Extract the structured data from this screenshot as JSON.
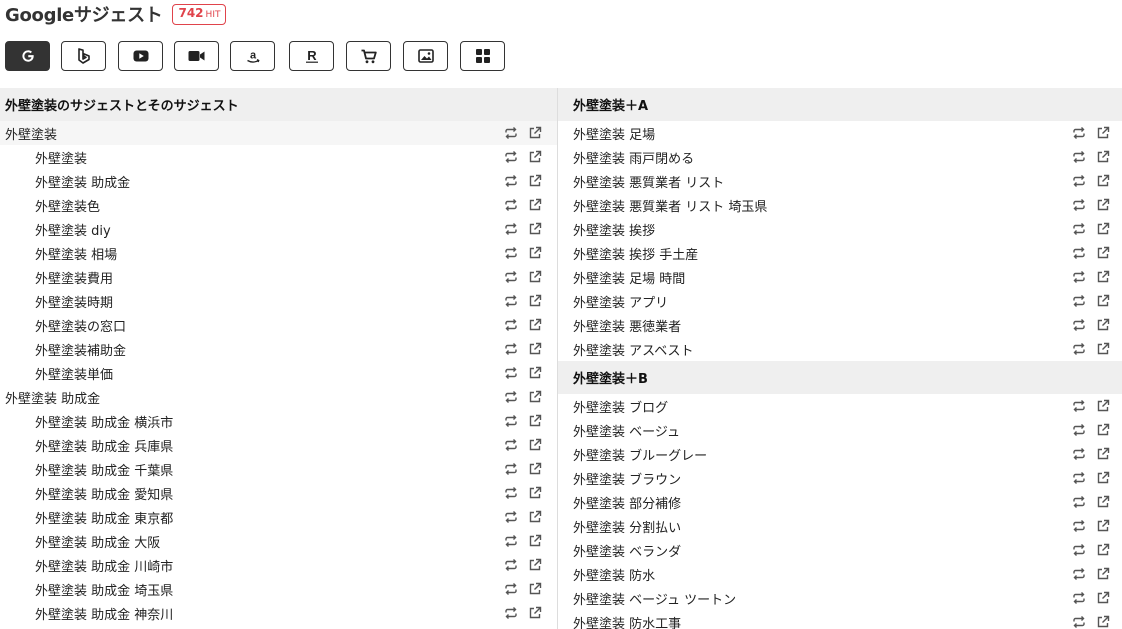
{
  "page": {
    "title": "Googleサジェスト",
    "hit_count": "742",
    "hit_label": "HIT"
  },
  "tabs": [
    {
      "name": "google",
      "icon": "google-icon",
      "active": true
    },
    {
      "name": "bing",
      "icon": "bing-icon",
      "active": false
    },
    {
      "name": "youtube",
      "icon": "youtube-icon",
      "active": false
    },
    {
      "name": "video",
      "icon": "video-camera-icon",
      "active": false
    },
    {
      "name": "amazon",
      "icon": "amazon-icon",
      "active": false
    },
    {
      "name": "rakuten",
      "icon": "rakuten-icon",
      "active": false
    },
    {
      "name": "shopping",
      "icon": "cart-icon",
      "active": false
    },
    {
      "name": "image",
      "icon": "image-icon",
      "active": false
    },
    {
      "name": "apps",
      "icon": "grid-icon",
      "active": false
    }
  ],
  "left_section": {
    "header": "外壁塗装のサジェストとそのサジェスト",
    "groups": [
      {
        "label": "外壁塗装",
        "children": [
          "外壁塗装",
          "外壁塗装 助成金",
          "外壁塗装色",
          "外壁塗装 diy",
          "外壁塗装 相場",
          "外壁塗装費用",
          "外壁塗装時期",
          "外壁塗装の窓口",
          "外壁塗装補助金",
          "外壁塗装単価"
        ]
      },
      {
        "label": "外壁塗装 助成金",
        "children": [
          "外壁塗装 助成金 横浜市",
          "外壁塗装 助成金 兵庫県",
          "外壁塗装 助成金 千葉県",
          "外壁塗装 助成金 愛知県",
          "外壁塗装 助成金 東京都",
          "外壁塗装 助成金 大阪",
          "外壁塗装 助成金 川崎市",
          "外壁塗装 助成金 埼玉県",
          "外壁塗装 助成金 神奈川"
        ]
      }
    ]
  },
  "right_sections": [
    {
      "header": "外壁塗装＋A",
      "items": [
        "外壁塗装 足場",
        "外壁塗装 雨戸閉める",
        "外壁塗装 悪質業者 リスト",
        "外壁塗装 悪質業者 リスト 埼玉県",
        "外壁塗装 挨拶",
        "外壁塗装 挨拶 手土産",
        "外壁塗装 足場 時間",
        "外壁塗装 アプリ",
        "外壁塗装 悪徳業者",
        "外壁塗装 アスベスト"
      ]
    },
    {
      "header": "外壁塗装＋B",
      "items": [
        "外壁塗装 ブログ",
        "外壁塗装 ベージュ",
        "外壁塗装 ブルーグレー",
        "外壁塗装 ブラウン",
        "外壁塗装 部分補修",
        "外壁塗装 分割払い",
        "外壁塗装 ベランダ",
        "外壁塗装 防水",
        "外壁塗装 ベージュ ツートン",
        "外壁塗装 防水工事"
      ]
    }
  ],
  "row_actions": {
    "resuggest_icon": "repeat-icon",
    "open_icon": "external-link-icon"
  },
  "colors": {
    "accent": "#e0434b",
    "tab_active": "#333333",
    "section_bg": "#efefef"
  }
}
